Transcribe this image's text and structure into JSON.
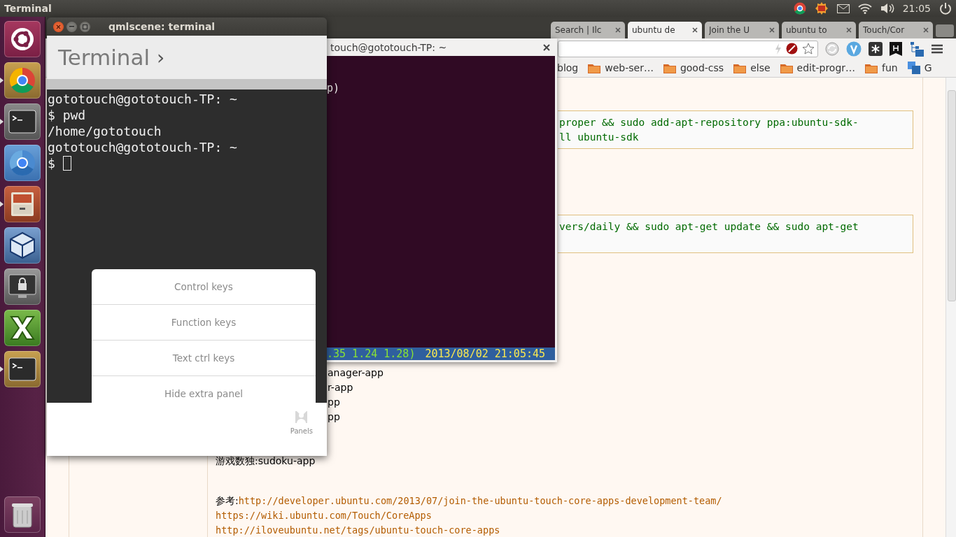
{
  "top_panel": {
    "app_title": "Terminal",
    "clock": "21:05"
  },
  "launcher": {
    "items": [
      {
        "kind": "ubuntu",
        "running": false
      },
      {
        "kind": "chrome",
        "running": true
      },
      {
        "kind": "terminal",
        "running": true
      },
      {
        "kind": "chromium",
        "running": false
      },
      {
        "kind": "files",
        "running": true
      },
      {
        "kind": "virtualbox",
        "running": false
      },
      {
        "kind": "lock",
        "running": false
      },
      {
        "kind": "xmind",
        "running": false
      },
      {
        "kind": "terminal_dark",
        "running": true
      },
      {
        "kind": "trash",
        "running": false
      }
    ]
  },
  "browser": {
    "tabs": [
      {
        "label": "Search | Ilc",
        "selected": false
      },
      {
        "label": "ubuntu de",
        "selected": true
      },
      {
        "label": "Join the U",
        "selected": false
      },
      {
        "label": "ubuntu to",
        "selected": false
      },
      {
        "label": "Touch/Cor",
        "selected": false
      }
    ],
    "bookmarks": [
      {
        "label": "blog",
        "kind": "text"
      },
      {
        "label": "web-ser…",
        "kind": "folder"
      },
      {
        "label": "good-css",
        "kind": "folder"
      },
      {
        "label": "else",
        "kind": "folder"
      },
      {
        "label": "edit-progr…",
        "kind": "folder"
      },
      {
        "label": "fun",
        "kind": "folder"
      },
      {
        "label": "G",
        "kind": "translate"
      }
    ],
    "code_boxes": [
      {
        "lines": [
          "proper && sudo add-apt-repository ppa:ubuntu-sdk-",
          "ll ubuntu-sdk"
        ]
      },
      {
        "lines": [
          "vers/daily && sudo apt-get update && sudo apt-get"
        ]
      }
    ],
    "partial_lines": [
      "anager-app",
      "r-app",
      "pp",
      "pp"
    ],
    "sudoku_line": "游戏数独:sudoku-app",
    "references": [
      {
        "prefix": "参考:",
        "link": "http://developer.ubuntu.com/2013/07/join-the-ubuntu-touch-core-apps-development-team/"
      },
      {
        "link": "https://wiki.ubuntu.com/Touch/CoreApps"
      },
      {
        "link": "http://iloveubuntu.net/tags/ubuntu-touch-core-apps"
      }
    ]
  },
  "gnome_terminal": {
    "title": "touch@gototouch-TP: ~",
    "lines": [
      "p)"
    ],
    "status_load": ".35 1.24 1.28)",
    "status_time": "2013/08/02 21:05:45"
  },
  "qml_window": {
    "title": "qmlscene: terminal",
    "header": "Terminal",
    "header_chevron": "›",
    "output": [
      "gototouch@gototouch-TP: ~",
      "$ pwd",
      "/home/gototouch",
      "gototouch@gototouch-TP: ~",
      "$"
    ],
    "panel_menu": [
      "Control keys",
      "Function keys",
      "Text ctrl keys",
      "Hide extra panel"
    ],
    "toolbar_button": "Panels"
  }
}
